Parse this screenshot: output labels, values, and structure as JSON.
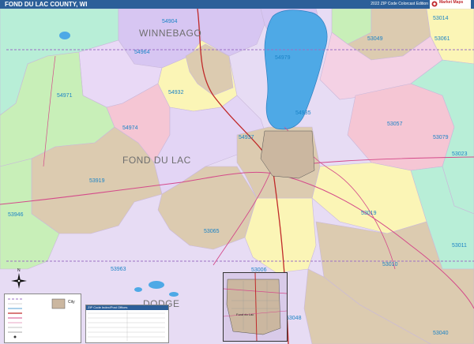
{
  "header": {
    "title": "FOND DU LAC COUNTY, WI",
    "edition": "2022 ZIP Code Colorcast Edition",
    "brand": "Market Maps"
  },
  "map": {
    "county_labels": [
      "WINNEBAGO",
      "FOND DU LAC",
      "DODGE"
    ],
    "zips": [
      "54904",
      "53014",
      "54964",
      "53049",
      "53061",
      "54979",
      "54971",
      "54932",
      "54935",
      "53057",
      "54974",
      "54937",
      "53079",
      "53023",
      "53919",
      "53946",
      "53019",
      "53065",
      "53011",
      "53963",
      "53006",
      "53010",
      "53048",
      "54935",
      "53040"
    ],
    "water_color": "#4ea9e6",
    "legend_title": "City"
  },
  "inset": {
    "title": "Fond du Lac"
  },
  "table": {
    "title": "ZIP Code Index/Post Offices"
  },
  "compass_letter": "N"
}
